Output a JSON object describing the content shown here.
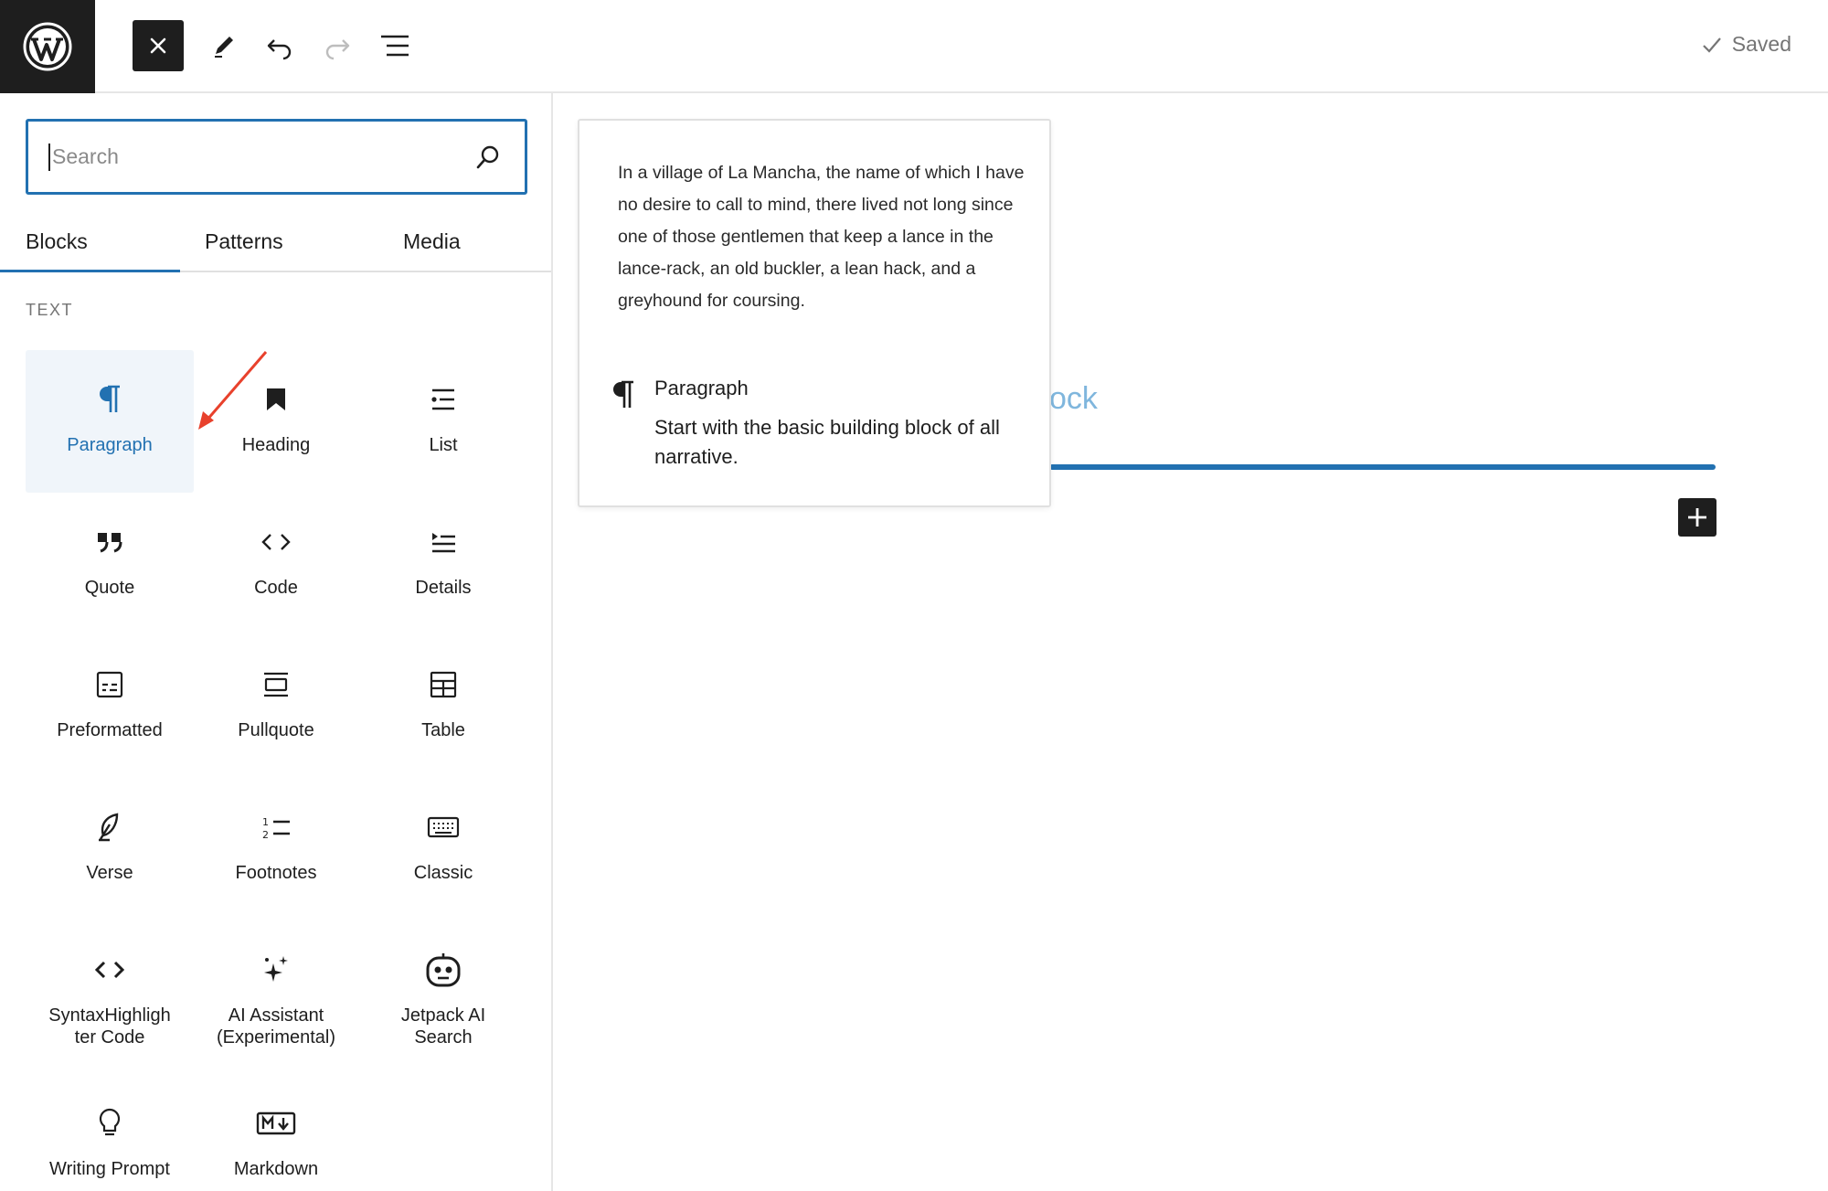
{
  "topbar": {
    "logo_icon": "wordpress-logo-icon",
    "close_icon": "close-icon",
    "edit_icon": "pencil-icon",
    "undo_icon": "undo-icon",
    "redo_icon": "redo-icon",
    "list_view_icon": "list-view-icon",
    "saved_label": "Saved"
  },
  "search": {
    "placeholder": "Search",
    "value": ""
  },
  "tabs": [
    {
      "label": "Blocks",
      "active": true
    },
    {
      "label": "Patterns",
      "active": false
    },
    {
      "label": "Media",
      "active": false
    }
  ],
  "section": {
    "title": "TEXT"
  },
  "blocks": [
    {
      "label": "Paragraph",
      "icon": "paragraph-icon",
      "selected": true
    },
    {
      "label": "Heading",
      "icon": "bookmark-icon",
      "selected": false
    },
    {
      "label": "List",
      "icon": "list-icon",
      "selected": false
    },
    {
      "label": "Quote",
      "icon": "quote-icon",
      "selected": false
    },
    {
      "label": "Code",
      "icon": "code-icon",
      "selected": false
    },
    {
      "label": "Details",
      "icon": "details-icon",
      "selected": false
    },
    {
      "label": "Preformatted",
      "icon": "preformatted-icon",
      "selected": false
    },
    {
      "label": "Pullquote",
      "icon": "pullquote-icon",
      "selected": false
    },
    {
      "label": "Table",
      "icon": "table-icon",
      "selected": false
    },
    {
      "label": "Verse",
      "icon": "feather-icon",
      "selected": false
    },
    {
      "label": "Footnotes",
      "icon": "footnotes-icon",
      "selected": false
    },
    {
      "label": "Classic",
      "icon": "keyboard-icon",
      "selected": false
    },
    {
      "label": "SyntaxHighligh ter Code",
      "icon": "syntax-code-icon",
      "selected": false
    },
    {
      "label": "AI Assistant (Experimental)",
      "icon": "sparkles-icon",
      "selected": false
    },
    {
      "label": "Jetpack AI Search",
      "icon": "robot-icon",
      "selected": false
    },
    {
      "label": "Writing Prompt",
      "icon": "lightbulb-icon",
      "selected": false
    },
    {
      "label": "Markdown",
      "icon": "markdown-icon",
      "selected": false
    }
  ],
  "preview": {
    "sample_text": "In a village of La Mancha, the name of which I have no desire to call to mind, there lived not long since one of those gentlemen that keep a lance in the lance-rack, an old buckler, a lean hack, and a greyhound for coursing.",
    "card_title": "Paragraph",
    "card_description": "Start with the basic building block of all narrative."
  },
  "canvas": {
    "ghost_text": "ock",
    "add_block_icon": "plus-icon"
  },
  "colors": {
    "accent": "#2271b1",
    "dark": "#1e1e1e",
    "arrow": "#e8412c"
  }
}
